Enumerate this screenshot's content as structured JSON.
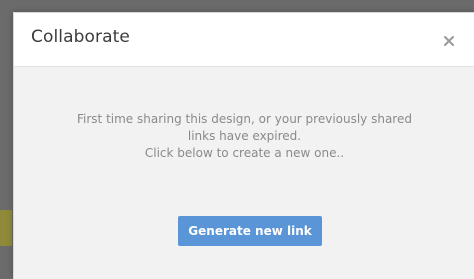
{
  "dialog": {
    "title": "Collaborate",
    "close_icon": "close-icon",
    "message_lines": [
      "First time sharing this design, or your previously shared",
      "links have expired.",
      "Click below to create a new one.."
    ],
    "generate_button_label": "Generate new link",
    "colors": {
      "primary_button": "#5a95d8",
      "message_text": "#8a8a8a",
      "title_text": "#3c3c3c"
    }
  }
}
